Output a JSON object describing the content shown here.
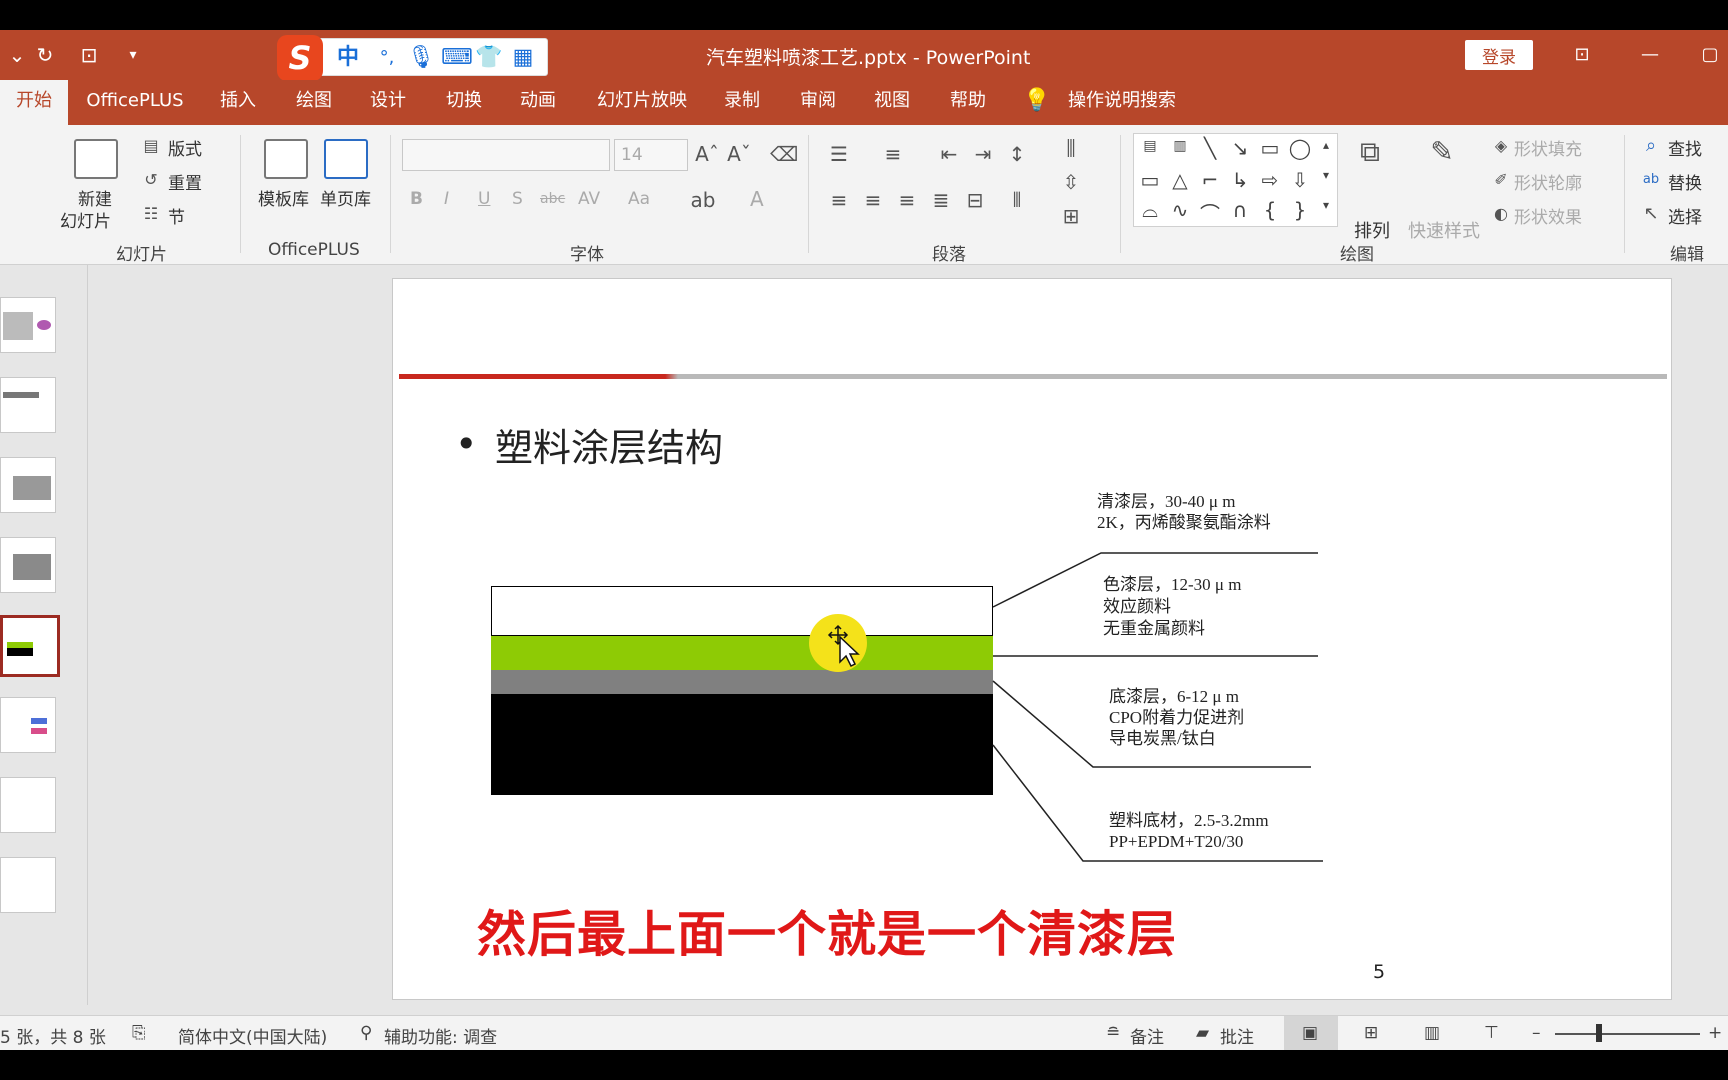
{
  "titlebar": {
    "doc_title": "汽车塑料喷漆工艺.pptx  -  PowerPoint",
    "login": "登录",
    "ime_cn": "中",
    "ime_punct": "°,"
  },
  "tabs": [
    {
      "label": "开始",
      "active": true
    },
    {
      "label": "OfficePLUS"
    },
    {
      "label": "插入"
    },
    {
      "label": "绘图"
    },
    {
      "label": "设计"
    },
    {
      "label": "切换"
    },
    {
      "label": "动画"
    },
    {
      "label": "幻灯片放映"
    },
    {
      "label": "录制"
    },
    {
      "label": "审阅"
    },
    {
      "label": "视图"
    },
    {
      "label": "帮助"
    },
    {
      "label": "操作说明搜索"
    }
  ],
  "ribbon": {
    "slides": {
      "new_slide_1": "新建",
      "new_slide_2": "幻灯片",
      "layout": "版式",
      "reset": "重置",
      "section": "节",
      "group": "幻灯片"
    },
    "officeplus": {
      "templates": "模板库",
      "single_page": "单页库",
      "group": "OfficePLUS"
    },
    "font": {
      "size": "14",
      "group": "字体",
      "bold": "B",
      "italic": "I",
      "underline": "U",
      "shadow": "S",
      "strike": "abc",
      "spacing": "AV",
      "case": "Aa",
      "color": "A"
    },
    "paragraph": {
      "group": "段落"
    },
    "drawing": {
      "arrange": "排列",
      "quick_styles": "快速样式",
      "fill": "形状填充",
      "outline": "形状轮廓",
      "effects": "形状效果",
      "group": "绘图"
    },
    "editing": {
      "find": "查找",
      "replace": "替换",
      "select": "选择",
      "group": "编辑"
    }
  },
  "slide": {
    "heading": "塑料涂层结构",
    "bullet": "•",
    "labels": {
      "clear_1": "清漆层，30-40 μ m",
      "clear_2": "2K，丙烯酸聚氨酯涂料",
      "color_1": "色漆层，12-30 μ m",
      "color_2": "效应颜料",
      "color_3": "无重金属颜料",
      "primer_1": "底漆层，6-12 μ m",
      "primer_2": "CPO附着力促进剂",
      "primer_3": "导电炭黑/钛白",
      "sub_1": "塑料底材，2.5-3.2mm",
      "sub_2": "PP+EPDM+T20/30"
    },
    "layer_colors": {
      "clear": "#ffffff",
      "color": "#8ecb05",
      "primer": "#808080",
      "substrate": "#000000"
    },
    "subtitle": "然后最上面一个就是一个清漆层",
    "page_number": "5"
  },
  "statusbar": {
    "slide_count": "5 张，共 8 张",
    "language": "简体中文(中国大陆)",
    "accessibility": "辅助功能: 调查",
    "notes": "备注",
    "comments": "批注",
    "zoom_minus": "–",
    "zoom_plus": "+"
  }
}
